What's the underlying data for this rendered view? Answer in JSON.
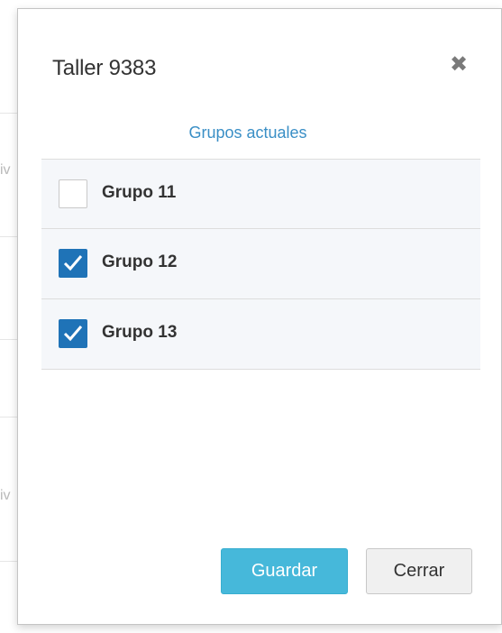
{
  "background": {
    "fragment_1": "iv",
    "fragment_2": "iv"
  },
  "modal": {
    "title": "Taller 9383",
    "close_glyph": "✖",
    "section_heading": "Grupos actuales",
    "groups": [
      {
        "label": "Grupo 11",
        "checked": false
      },
      {
        "label": "Grupo 12",
        "checked": true
      },
      {
        "label": "Grupo 13",
        "checked": true
      }
    ],
    "save_label": "Guardar",
    "close_label": "Cerrar"
  },
  "colors": {
    "accent_link": "#3a8fc6",
    "checkbox_checked": "#1f73b7",
    "save_button": "#46b8da",
    "row_background": "#f5f7fa"
  },
  "icons": {
    "close": "close-icon",
    "check": "checkmark-icon"
  }
}
